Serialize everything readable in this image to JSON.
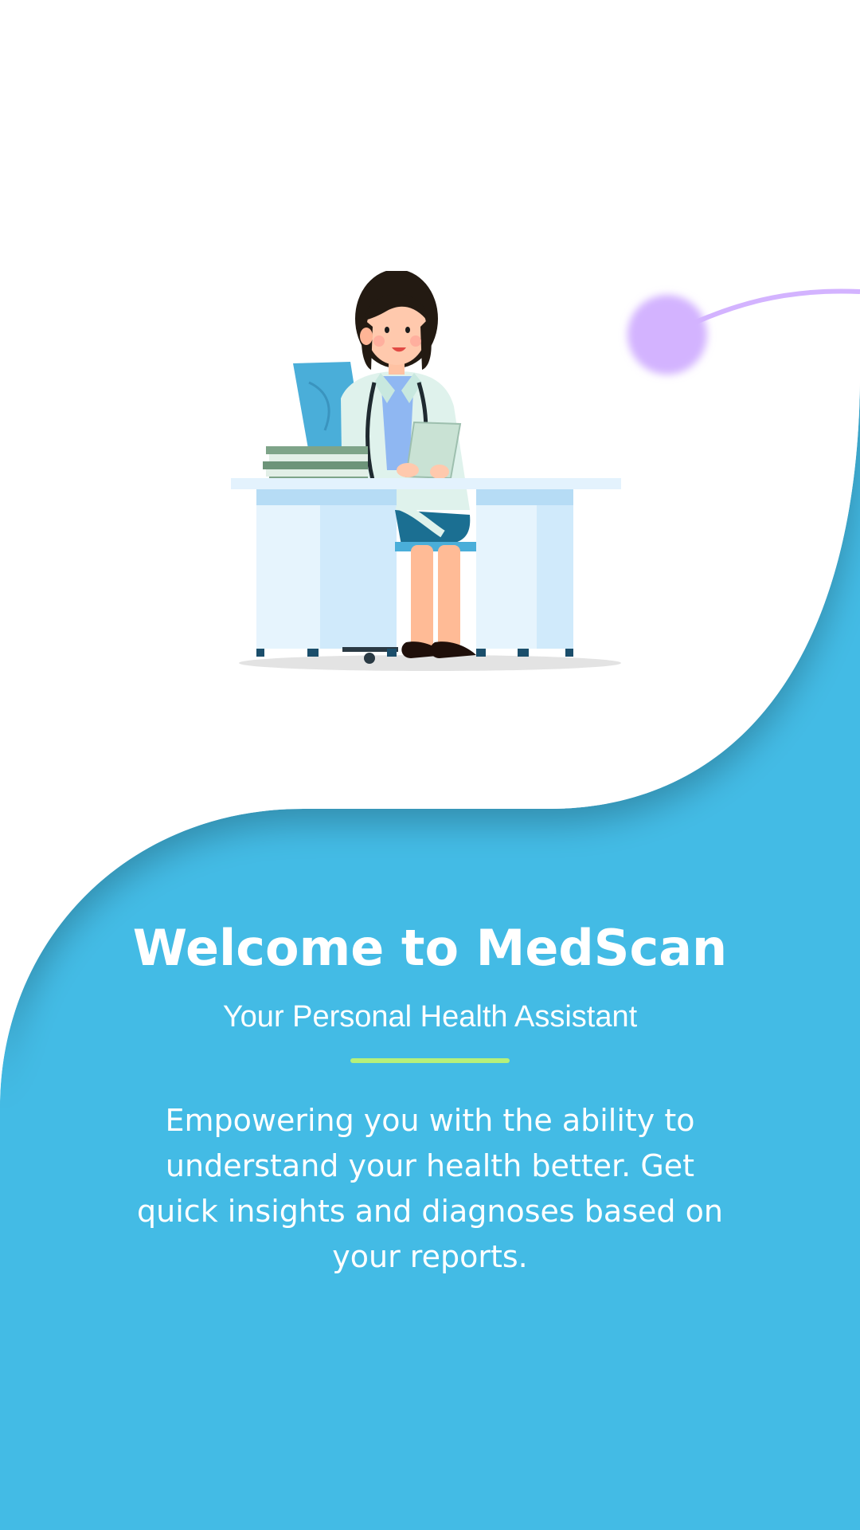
{
  "colors": {
    "background": "#ffffff",
    "wave": "#43bbe5",
    "accent_orb": "#d3b3ff",
    "divider": "#b6f07a",
    "text": "#ffffff"
  },
  "welcome": {
    "title": "Welcome to MedScan",
    "subtitle": "Your Personal Health Assistant",
    "description": "Empowering you with the ability to understand your health better. Get quick insights and diagnoses based on your reports."
  },
  "illustration": {
    "icon": "doctor-at-desk-illustration"
  }
}
